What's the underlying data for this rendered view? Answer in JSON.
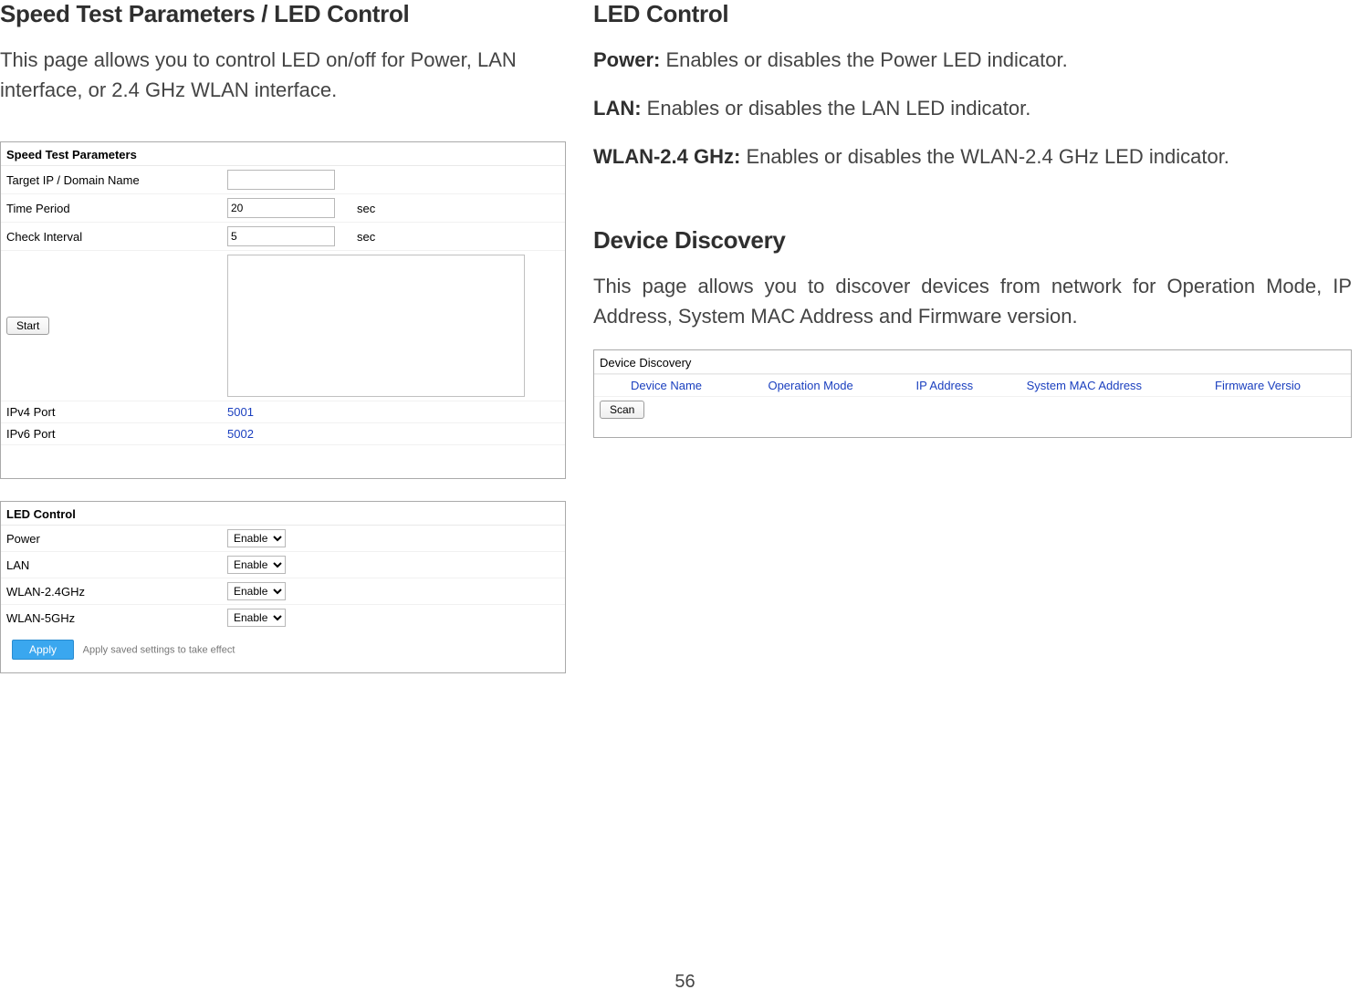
{
  "left": {
    "heading": "Speed Test Parameters / LED Control",
    "intro": "This page allows you to control LED on/off for Power, LAN interface, or 2.4 GHz WLAN interface.",
    "speed_panel": {
      "title": "Speed Test Parameters",
      "rows": {
        "target_label": "Target IP / Domain Name",
        "target_value": "",
        "time_label": "Time Period",
        "time_value": "20",
        "time_unit": "sec",
        "check_label": "Check Interval",
        "check_value": "5",
        "check_unit": "sec",
        "start_label": "Start",
        "ipv4_label": "IPv4 Port",
        "ipv4_value": "5001",
        "ipv6_label": "IPv6 Port",
        "ipv6_value": "5002"
      }
    },
    "led_panel": {
      "title": "LED Control",
      "rows": [
        {
          "label": "Power",
          "value": "Enable"
        },
        {
          "label": "LAN",
          "value": "Enable"
        },
        {
          "label": "WLAN-2.4GHz",
          "value": "Enable"
        },
        {
          "label": "WLAN-5GHz",
          "value": "Enable"
        }
      ],
      "apply_label": "Apply",
      "apply_note": "Apply saved settings to take effect"
    }
  },
  "right": {
    "heading": "LED Control",
    "power_bold": "Power:",
    "power_text": " Enables or disables the Power LED indicator.",
    "lan_bold": "LAN:",
    "lan_text": " Enables or disables the LAN LED indicator.",
    "wlan_bold": "WLAN-2.4 GHz:",
    "wlan_text": " Enables or disables the WLAN-2.4 GHz LED indicator.",
    "dd_heading": "Device Discovery",
    "dd_intro": "This page allows you to discover devices from network for Operation Mode, IP Address, System MAC Address and Firmware version.",
    "dd_panel": {
      "title": "Device Discovery",
      "headers": [
        "Device Name",
        "Operation Mode",
        "IP Address",
        "System MAC Address",
        "Firmware Versio"
      ],
      "scan_label": "Scan"
    }
  },
  "page_number": "56"
}
